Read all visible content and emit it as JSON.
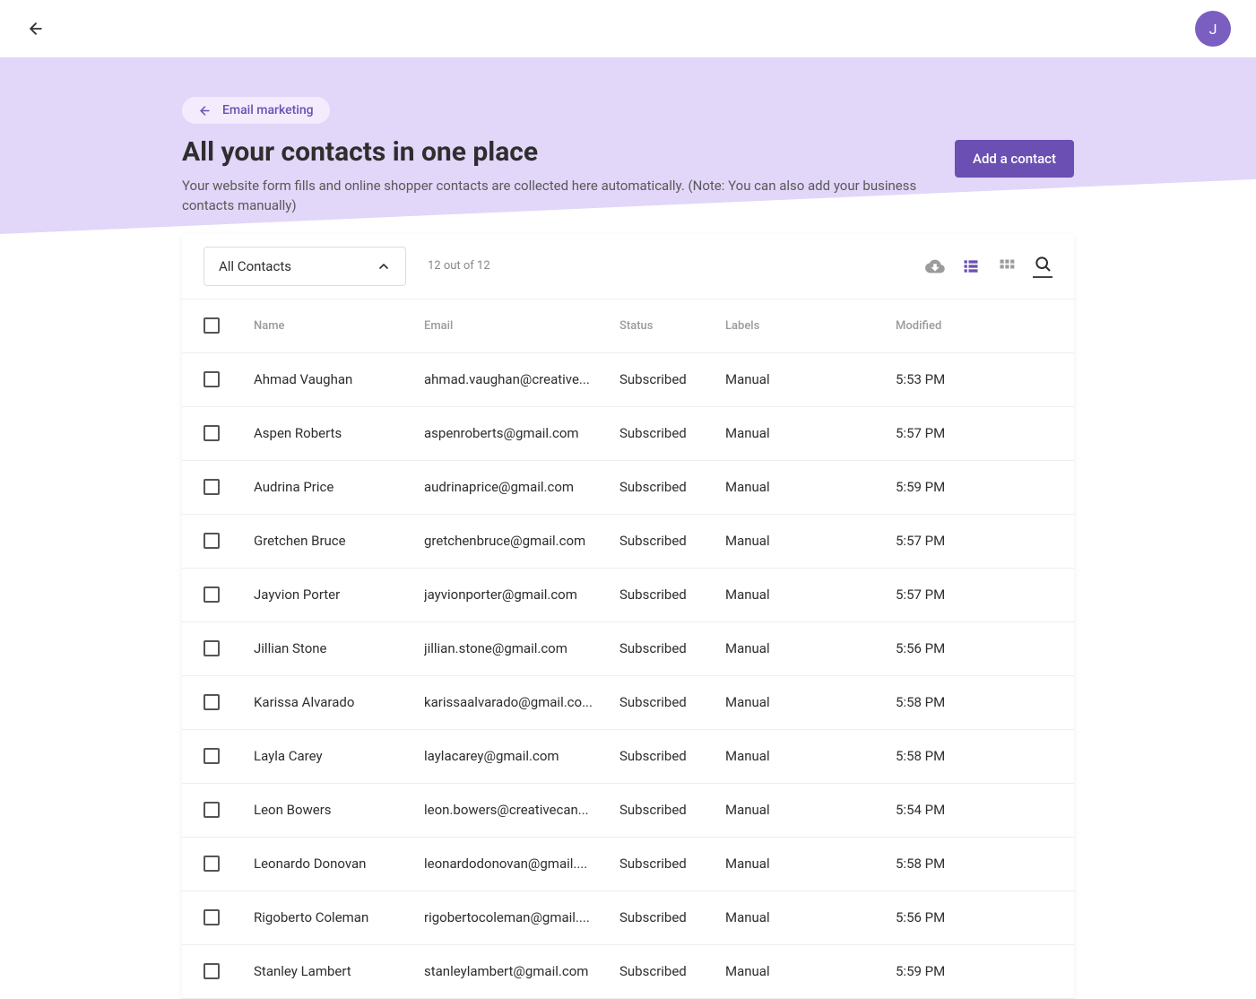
{
  "topbar": {
    "avatar_initial": "J"
  },
  "breadcrumb": {
    "label": "Email marketing"
  },
  "header": {
    "title": "All your contacts in one place",
    "subtitle": "Your website form fills and online shopper contacts are collected here automatically. (Note: You can also add your business contacts manually)",
    "add_button": "Add a contact"
  },
  "toolbar": {
    "filter_label": "All Contacts",
    "count_text": "12 out of 12"
  },
  "columns": {
    "name": "Name",
    "email": "Email",
    "status": "Status",
    "labels": "Labels",
    "modified": "Modified"
  },
  "rows": [
    {
      "name": "Ahmad Vaughan",
      "email": "ahmad.vaughan@creative...",
      "status": "Subscribed",
      "labels": "Manual",
      "modified": "5:53 PM"
    },
    {
      "name": "Aspen Roberts",
      "email": "aspenroberts@gmail.com",
      "status": "Subscribed",
      "labels": "Manual",
      "modified": "5:57 PM"
    },
    {
      "name": "Audrina Price",
      "email": "audrinaprice@gmail.com",
      "status": "Subscribed",
      "labels": "Manual",
      "modified": "5:59 PM"
    },
    {
      "name": "Gretchen Bruce",
      "email": "gretchenbruce@gmail.com",
      "status": "Subscribed",
      "labels": "Manual",
      "modified": "5:57 PM"
    },
    {
      "name": "Jayvion Porter",
      "email": "jayvionporter@gmail.com",
      "status": "Subscribed",
      "labels": "Manual",
      "modified": "5:57 PM"
    },
    {
      "name": "Jillian Stone",
      "email": "jillian.stone@gmail.com",
      "status": "Subscribed",
      "labels": "Manual",
      "modified": "5:56 PM"
    },
    {
      "name": "Karissa Alvarado",
      "email": "karissaalvarado@gmail.co...",
      "status": "Subscribed",
      "labels": "Manual",
      "modified": "5:58 PM"
    },
    {
      "name": "Layla Carey",
      "email": "laylacarey@gmail.com",
      "status": "Subscribed",
      "labels": "Manual",
      "modified": "5:58 PM"
    },
    {
      "name": "Leon Bowers",
      "email": "leon.bowers@creativecan...",
      "status": "Subscribed",
      "labels": "Manual",
      "modified": "5:54 PM"
    },
    {
      "name": "Leonardo Donovan",
      "email": "leonardodonovan@gmail....",
      "status": "Subscribed",
      "labels": "Manual",
      "modified": "5:58 PM"
    },
    {
      "name": "Rigoberto Coleman",
      "email": "rigobertocoleman@gmail....",
      "status": "Subscribed",
      "labels": "Manual",
      "modified": "5:56 PM"
    },
    {
      "name": "Stanley Lambert",
      "email": "stanleylambert@gmail.com",
      "status": "Subscribed",
      "labels": "Manual",
      "modified": "5:59 PM"
    }
  ]
}
